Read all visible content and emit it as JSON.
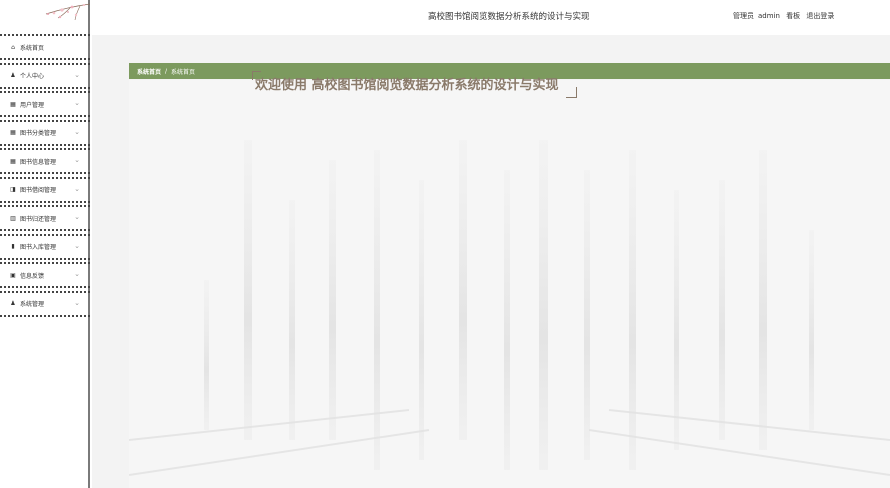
{
  "header": {
    "title": "高校图书馆阅览数据分析系统的设计与实现",
    "user_role": "管理员",
    "user_name": "admin",
    "board_link": "看板",
    "logout_link": "退出登录"
  },
  "sidebar": {
    "items": [
      {
        "label": "系统首页",
        "icon": "home-icon",
        "glyph": "⌂",
        "has_arrow": false
      },
      {
        "label": "个人中心",
        "icon": "user-icon",
        "glyph": "♟",
        "has_arrow": true
      },
      {
        "label": "用户管理",
        "icon": "grid-icon",
        "glyph": "▦",
        "has_arrow": true
      },
      {
        "label": "图书分类管理",
        "icon": "grid-icon",
        "glyph": "▦",
        "has_arrow": true
      },
      {
        "label": "图书信息管理",
        "icon": "grid-icon",
        "glyph": "▦",
        "has_arrow": true
      },
      {
        "label": "图书借阅管理",
        "icon": "book-open-icon",
        "glyph": "◨",
        "has_arrow": true
      },
      {
        "label": "图书归还管理",
        "icon": "book-icon",
        "glyph": "▥",
        "has_arrow": true
      },
      {
        "label": "图书入库管理",
        "icon": "bar-chart-icon",
        "glyph": "▮",
        "has_arrow": true
      },
      {
        "label": "信息反馈",
        "icon": "feedback-icon",
        "glyph": "▣",
        "has_arrow": true
      },
      {
        "label": "系统管理",
        "icon": "user-icon",
        "glyph": "♟",
        "has_arrow": true
      }
    ]
  },
  "breadcrumb": {
    "home": "系统首页",
    "separator": "/",
    "current": "系统首页"
  },
  "welcome": {
    "text": "欢迎使用 高校图书馆阅览数据分析系统的设计与实现"
  },
  "colors": {
    "accent": "#7c9a5e",
    "welcome_text": "#8a7a6a",
    "sidebar_border": "#7a7a7a"
  }
}
